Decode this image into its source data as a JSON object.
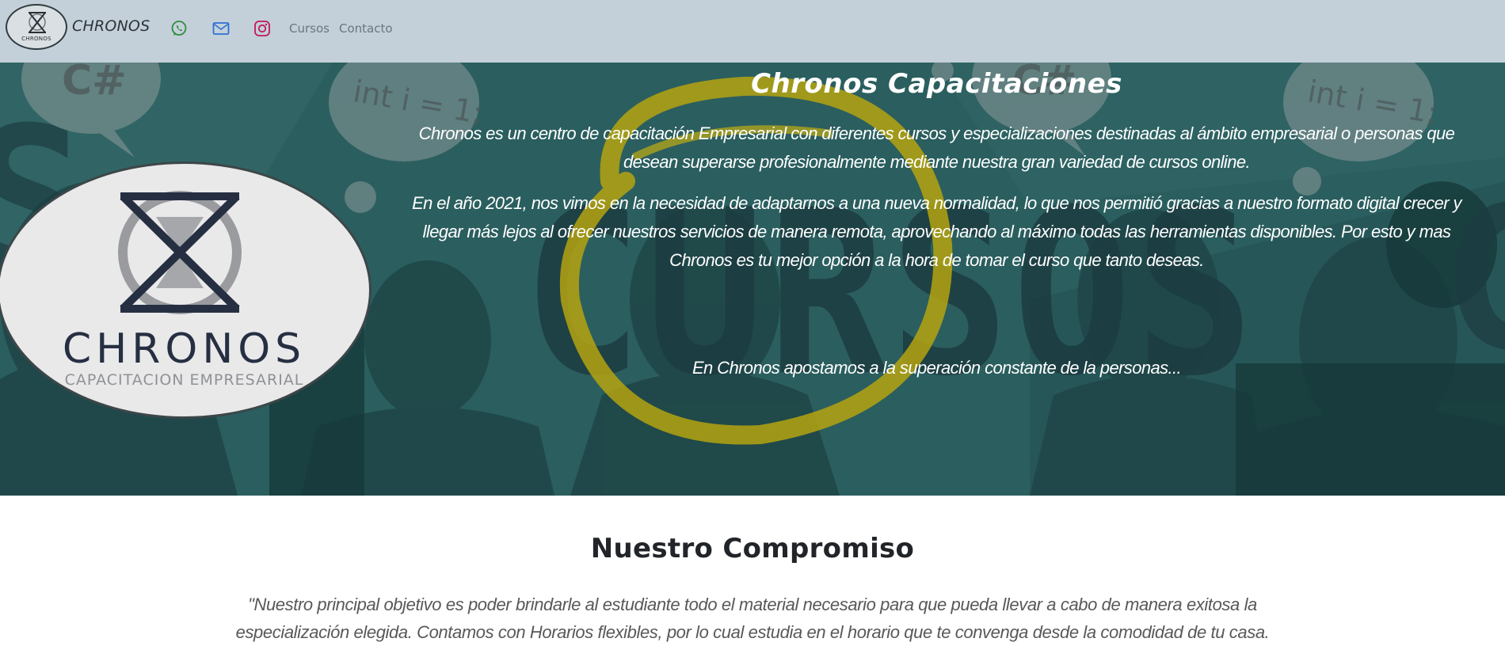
{
  "navbar": {
    "logo_text": "CHRONOS",
    "brand": "CHRONOS",
    "icons": [
      "whatsapp-icon",
      "mail-icon",
      "instagram-icon"
    ],
    "links": [
      "Cursos",
      "Contacto"
    ],
    "background": "#c3d0d9"
  },
  "hero": {
    "background_words": [
      "CURSOS"
    ],
    "bubble_texts": [
      "C#",
      "int i = 1;",
      "C#",
      "int i = 1;"
    ],
    "logo": {
      "title": "CHRONOS",
      "subtitle": "CAPACITACION EMPRESARIAL"
    },
    "title": "Chronos  Capacitaciones",
    "paragraph_1": "Chronos es un centro de capacitación Empresarial con diferentes cursos y especializaciones destinadas al ámbito empresarial o personas que desean superarse profesionalmente mediante nuestra gran variedad de cursos online.",
    "paragraph_2": "En el año 2021, nos vimos en la necesidad de adaptarnos a una nueva normalidad, lo que nos permitió gracias a nuestro formato digital crecer y llegar más lejos al ofrecer nuestros servicios de manera remota, aprovechando al máximo todas las herramientas disponibles. Por esto y mas Chronos es tu mejor opción a la hora de tomar el curso que tanto deseas.",
    "paragraph_3": "En Chronos apostamos a la superación constante de la personas...",
    "background": "#2b5e5f",
    "accent": "#b5a30f"
  },
  "commitment": {
    "title": "Nuestro  Compromiso",
    "text": "\"Nuestro principal objetivo es poder brindarle al estudiante todo el material necesario para que pueda llevar a cabo de manera exitosa la especialización elegida. Contamos con Horarios flexibles, por lo cual estudia en el horario que te convenga desde la comodidad de tu casa."
  }
}
